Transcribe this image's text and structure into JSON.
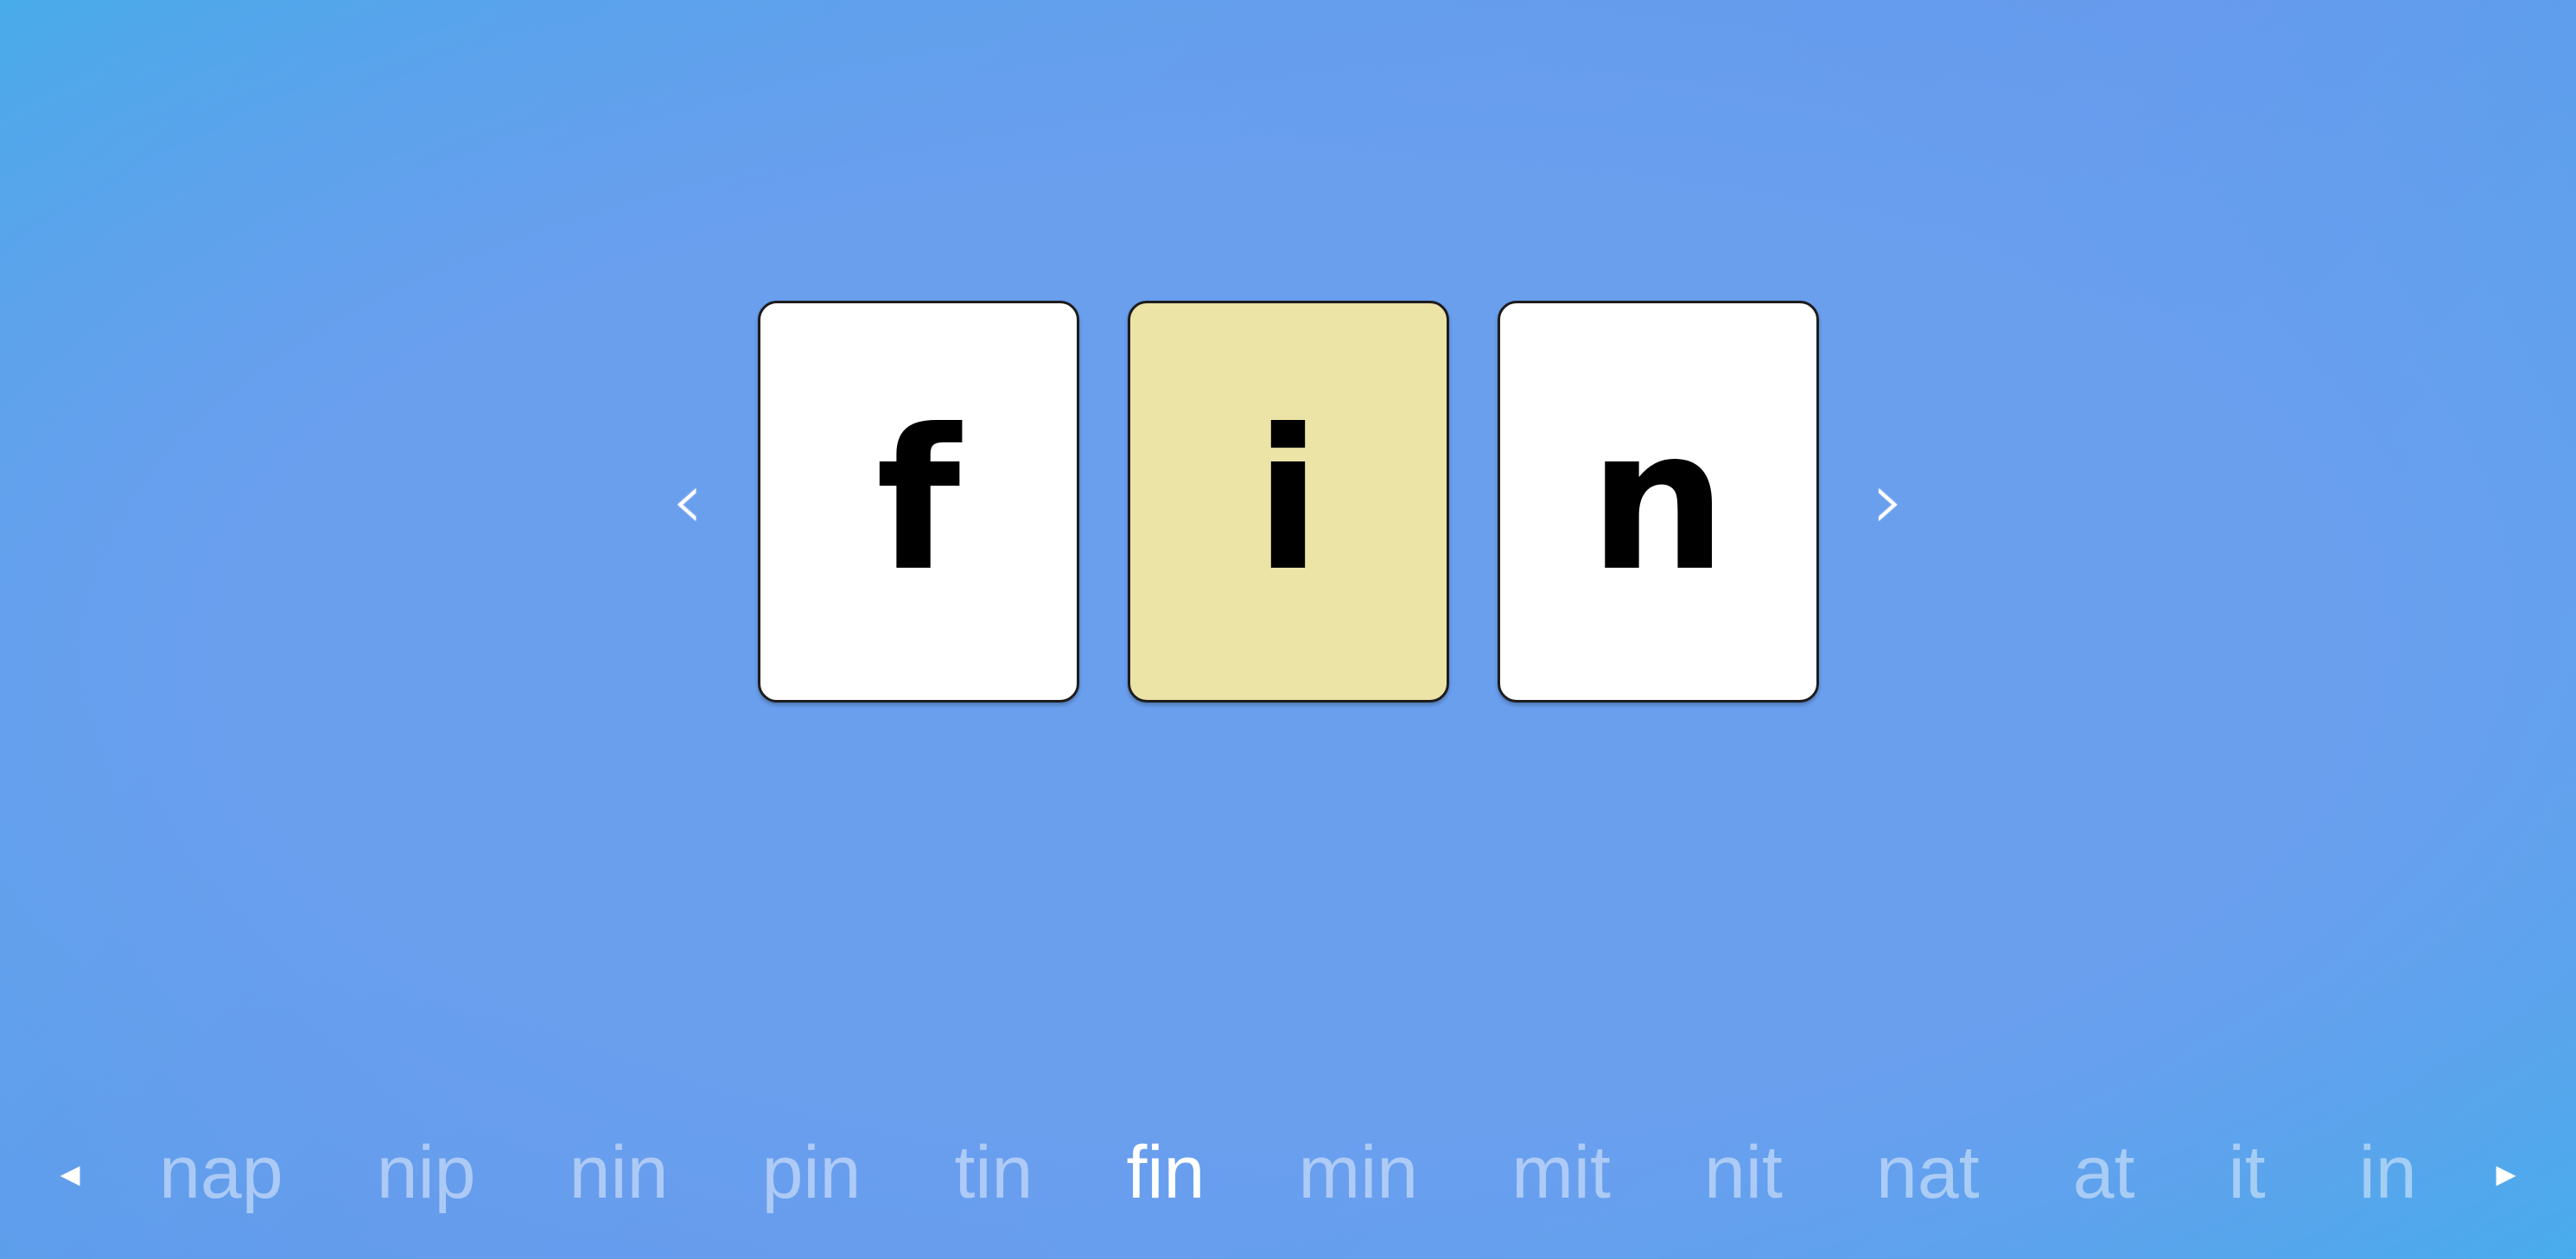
{
  "background": {
    "gradient_start": "#3bb0e8",
    "gradient_center": "#6397ec",
    "gradient_end": "#36b3ea"
  },
  "card_area": {
    "prev_icon": "‹",
    "next_icon": "›",
    "prev_label": "previous-letter",
    "next_label": "next-letter",
    "highlight_color": "#ece3a7",
    "cards": [
      {
        "letter": "f",
        "highlighted": false
      },
      {
        "letter": "i",
        "highlighted": true
      },
      {
        "letter": "n",
        "highlighted": false
      }
    ]
  },
  "word_strip": {
    "prev_icon": "◂",
    "next_icon": "▸",
    "active_word": "fin",
    "active_index": 5,
    "words": [
      {
        "text": "nap",
        "active": false
      },
      {
        "text": "nip",
        "active": false
      },
      {
        "text": "nin",
        "active": false
      },
      {
        "text": "pin",
        "active": false
      },
      {
        "text": "tin",
        "active": false
      },
      {
        "text": "fin",
        "active": true
      },
      {
        "text": "min",
        "active": false
      },
      {
        "text": "mit",
        "active": false
      },
      {
        "text": "nit",
        "active": false
      },
      {
        "text": "nat",
        "active": false
      },
      {
        "text": "at",
        "active": false
      },
      {
        "text": "it",
        "active": false
      },
      {
        "text": "in",
        "active": false
      }
    ]
  }
}
